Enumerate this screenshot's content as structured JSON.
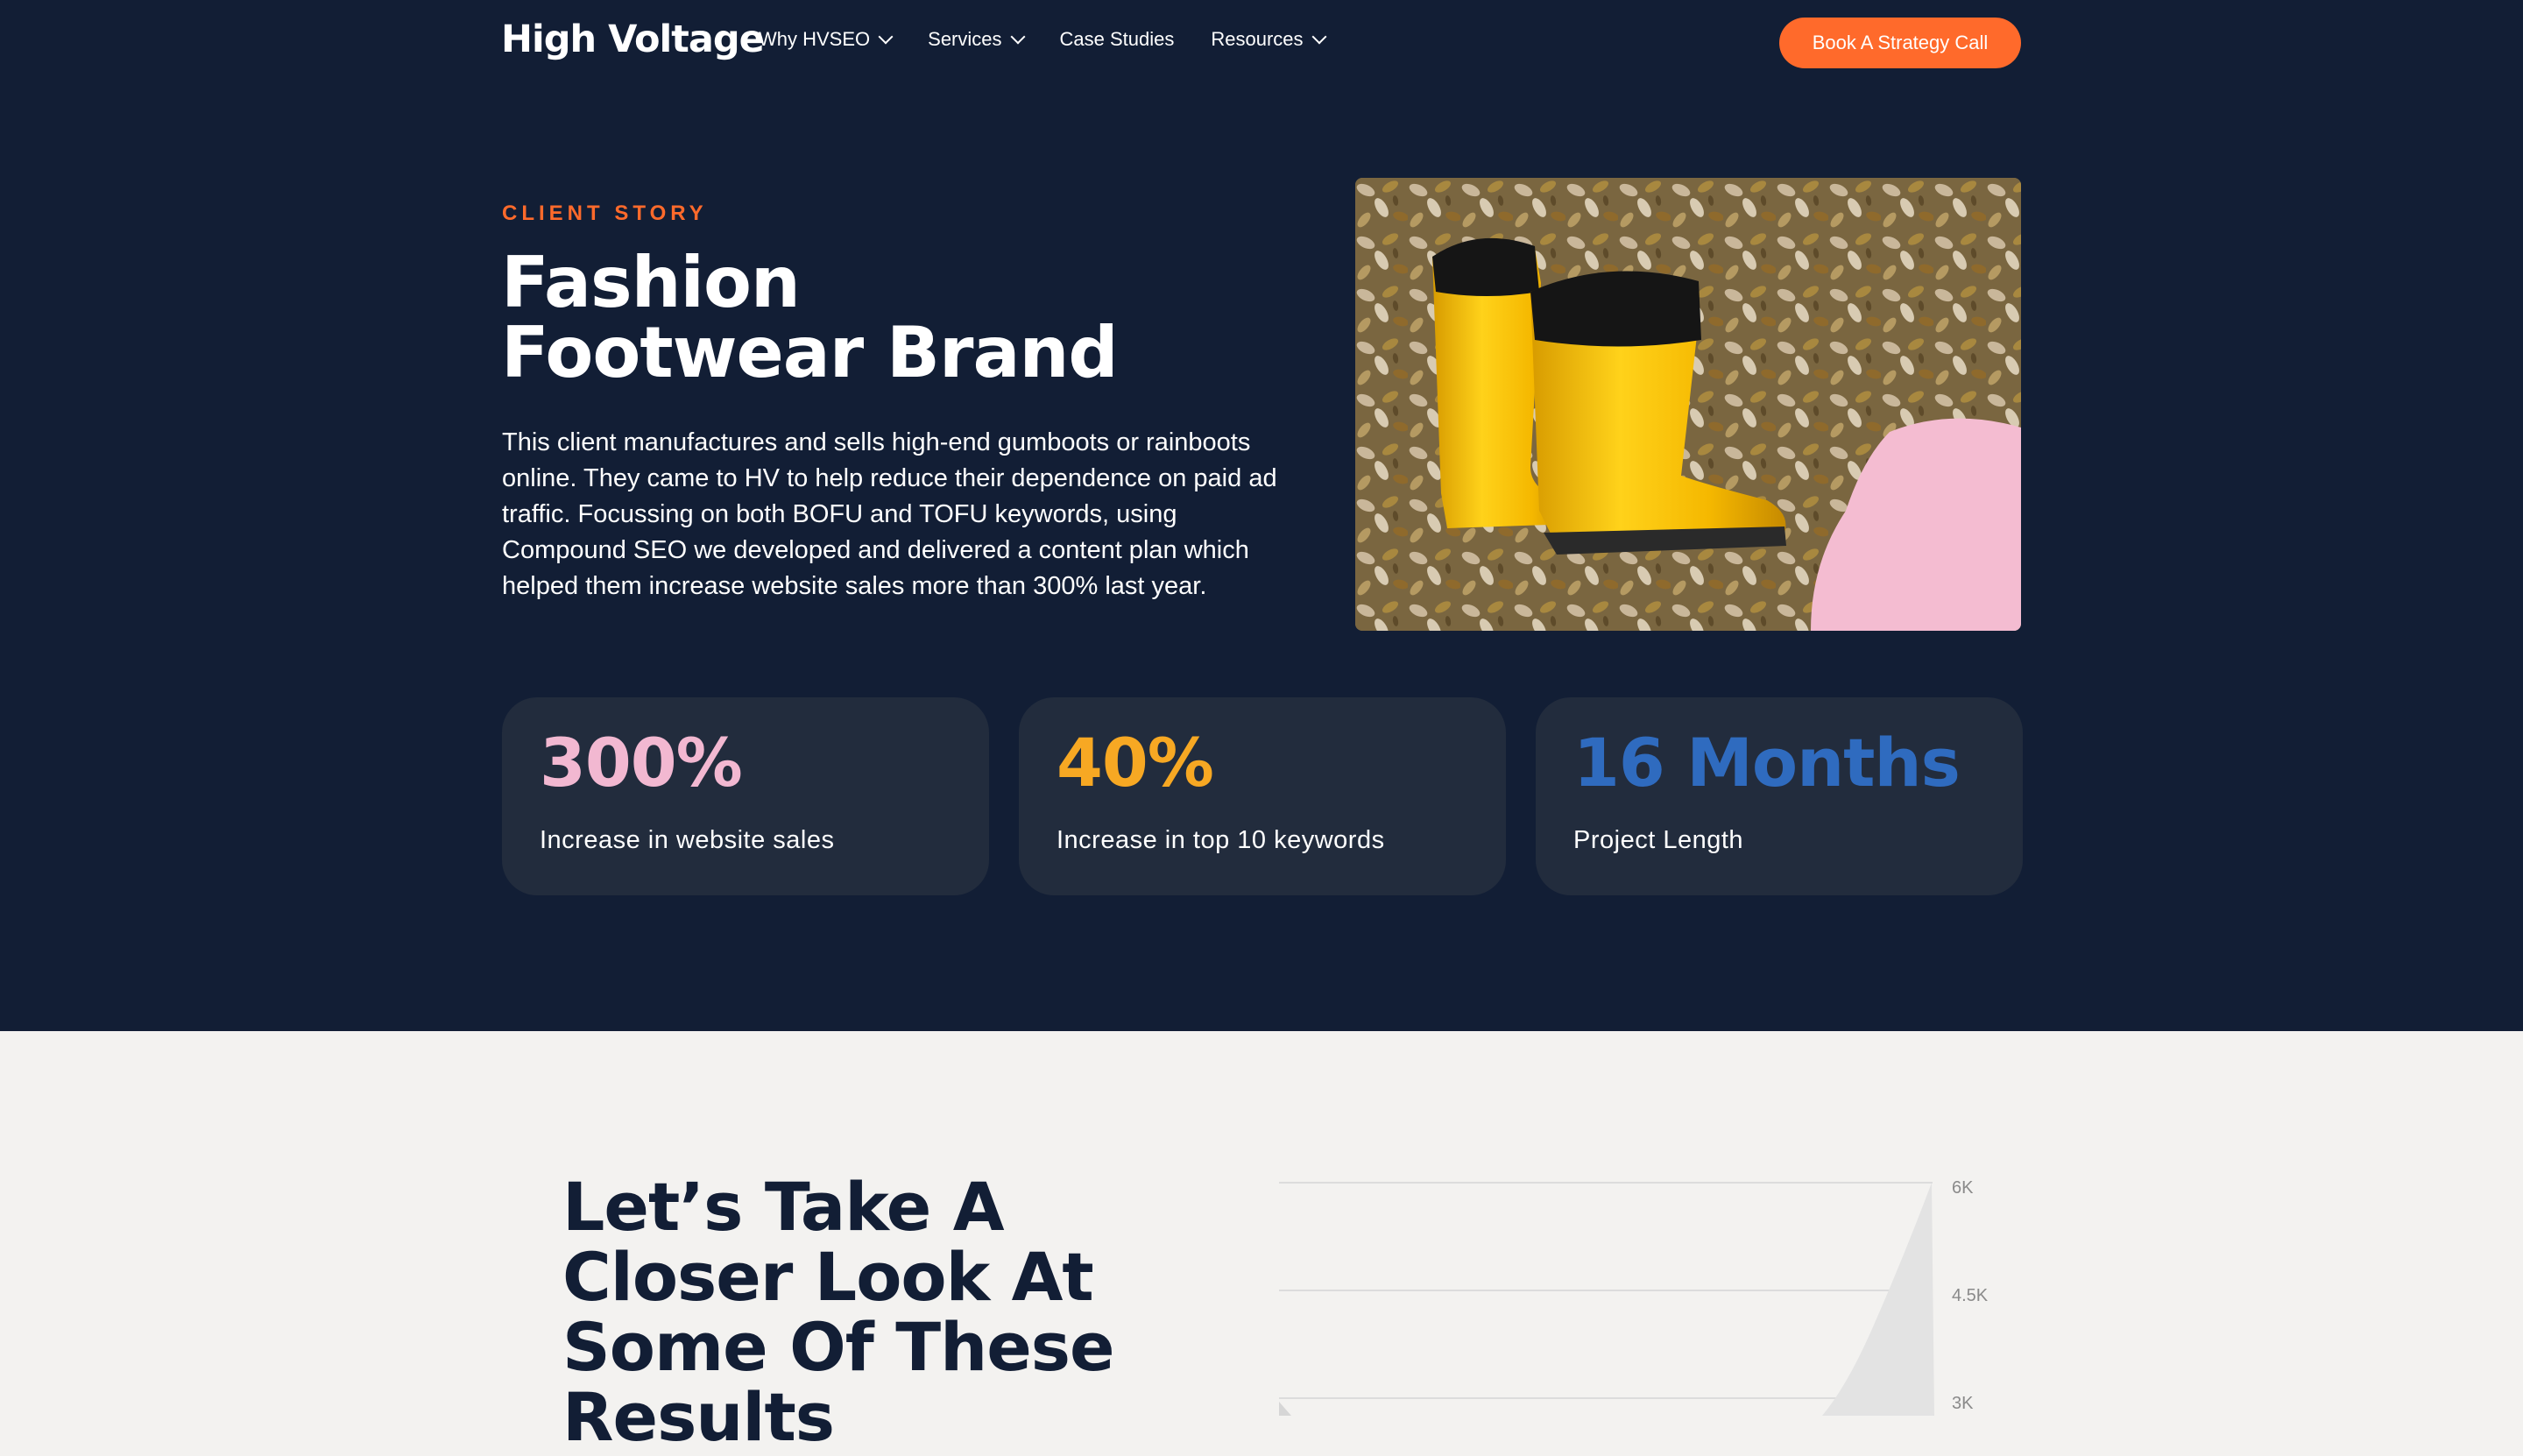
{
  "nav": {
    "logo": "High Voltage",
    "items": [
      {
        "label": "Why HVSEO",
        "dropdown": true
      },
      {
        "label": "Services",
        "dropdown": true
      },
      {
        "label": "Case Studies",
        "dropdown": false
      },
      {
        "label": "Resources",
        "dropdown": true
      }
    ],
    "cta": "Book A Strategy Call"
  },
  "hero": {
    "eyebrow": "CLIENT STORY",
    "title": "Fashion Footwear Brand",
    "description": "This client manufactures and sells high-end gumboots or rainboots online. They came to HV to help reduce their dependence on paid ad traffic. Focussing on both BOFU and TOFU keywords, using Compound SEO we developed and delivered a content plan which helped them increase website sales more than 300% last year.",
    "image_alt": "yellow rain boots on autumn leaves"
  },
  "stats": [
    {
      "value": "300%",
      "label": "Increase in website sales",
      "color": "#f2b8d1"
    },
    {
      "value": "40%",
      "label": "Increase in top 10 keywords",
      "color": "#f7a823"
    },
    {
      "value": "16 Months",
      "label": "Project Length",
      "color": "#2f6bbf"
    }
  ],
  "results": {
    "title": "Let’s Take A Closer Look At Some Of These Results"
  },
  "chart_data": {
    "type": "area",
    "title": "",
    "xlabel": "",
    "ylabel": "",
    "yticks": [
      "6K",
      "4.5K",
      "3K"
    ],
    "ylim": [
      3000,
      6000
    ],
    "grid": true
  },
  "colors": {
    "navy": "#121e35",
    "accent": "#ff6a2b",
    "card": "#222c3d",
    "section_bg": "#f3f2f0"
  }
}
